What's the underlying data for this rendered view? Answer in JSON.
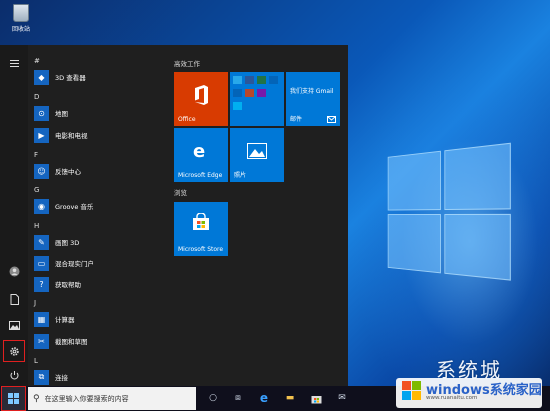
{
  "desktop": {
    "recycle_label": "回收站"
  },
  "rail": {
    "icons": [
      "hamburger-icon",
      "user-icon",
      "document-icon",
      "pictures-icon",
      "settings-icon",
      "power-icon"
    ]
  },
  "app_list": {
    "headers": [
      "#",
      "D",
      "F",
      "G",
      "H",
      "J",
      "L"
    ],
    "apps": [
      {
        "name": "3D 查看器",
        "color": "#1565c0"
      },
      {
        "name": "地图",
        "color": "#1565c0"
      },
      {
        "name": "电影和电视",
        "color": "#1565c0"
      },
      {
        "name": "反馈中心",
        "color": "#1565c0"
      },
      {
        "name": "Groove 音乐",
        "color": "#1565c0"
      },
      {
        "name": "画图 3D",
        "color": "#1565c0"
      },
      {
        "name": "混合现实门户",
        "color": "#1565c0"
      },
      {
        "name": "获取帮助",
        "color": "#1565c0"
      },
      {
        "name": "计算器",
        "color": "#1565c0"
      },
      {
        "name": "截图和草图",
        "color": "#1565c0"
      },
      {
        "name": "连接",
        "color": "#1565c0"
      }
    ]
  },
  "tiles": {
    "groups": [
      "高效工作",
      "浏览"
    ],
    "office_label": "Office",
    "office_color": "#d83b01",
    "gmail_text": "我们支持 Gmail",
    "mail_label": "邮件",
    "edge_label": "Microsoft Edge",
    "photos_label": "照片",
    "store_label": "Microsoft Store",
    "tile_color": "#0078d7"
  },
  "taskbar": {
    "search_placeholder": "在这里输入你要搜索的内容"
  },
  "watermark": {
    "top": "系统城",
    "main": "windows系统家园",
    "sub": "www.ruanaitu.com"
  }
}
